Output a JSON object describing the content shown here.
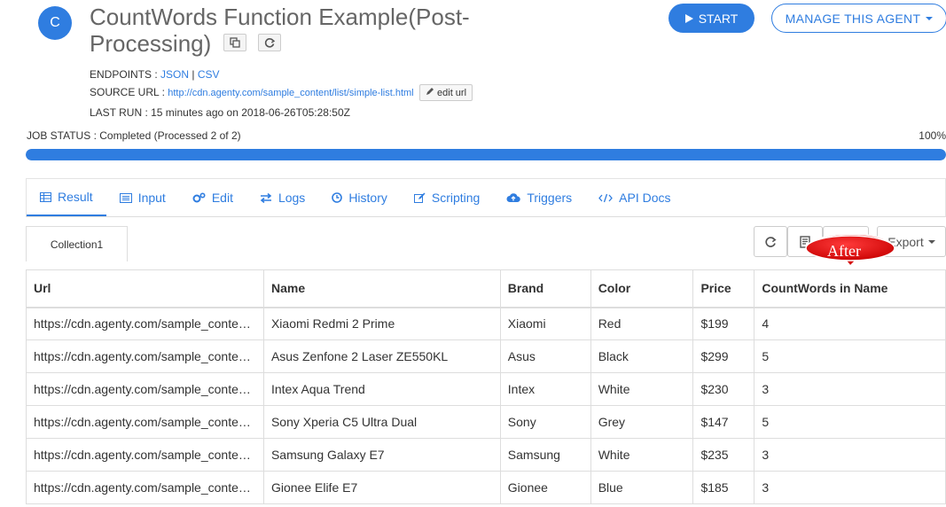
{
  "header": {
    "avatar_letter": "C",
    "title": "CountWords Function Example(Post-Processing)",
    "start_label": "START",
    "manage_label": "MANAGE THIS AGENT"
  },
  "meta": {
    "endpoints_label": "ENDPOINTS :",
    "json_link": "JSON",
    "separator": "|",
    "csv_link": "CSV",
    "source_label": "SOURCE URL :",
    "source_url": "http://cdn.agenty.com/sample_content/list/simple-list.html",
    "edit_url_label": "edit url",
    "last_run": "LAST RUN : 15 minutes ago on 2018-06-26T05:28:50Z"
  },
  "job": {
    "status": "JOB STATUS : Completed (Processed 2 of 2)",
    "percent": "100%",
    "progress": 1.0
  },
  "tabs": [
    {
      "label": "Result",
      "icon": "table-icon"
    },
    {
      "label": "Input",
      "icon": "list-icon"
    },
    {
      "label": "Edit",
      "icon": "gears-icon"
    },
    {
      "label": "Logs",
      "icon": "exchange-icon"
    },
    {
      "label": "History",
      "icon": "clock-icon"
    },
    {
      "label": "Scripting",
      "icon": "edit-icon"
    },
    {
      "label": "Triggers",
      "icon": "cloud-upload-icon"
    },
    {
      "label": "API Docs",
      "icon": "code-icon"
    }
  ],
  "collection_tab": "Collection1",
  "toolbar": {
    "export_label": "Export"
  },
  "annotation": "After",
  "table": {
    "headers": [
      "Url",
      "Name",
      "Brand",
      "Color",
      "Price",
      "CountWords in Name"
    ],
    "rows": [
      [
        "https://cdn.agenty.com/sample_conte…",
        "Xiaomi Redmi 2 Prime",
        "Xiaomi",
        "Red",
        "$199",
        "4"
      ],
      [
        "https://cdn.agenty.com/sample_conte…",
        "Asus Zenfone 2 Laser ZE550KL",
        "Asus",
        "Black",
        "$299",
        "5"
      ],
      [
        "https://cdn.agenty.com/sample_conte…",
        "Intex Aqua Trend",
        "Intex",
        "White",
        "$230",
        "3"
      ],
      [
        "https://cdn.agenty.com/sample_conte…",
        "Sony Xperia C5 Ultra Dual",
        "Sony",
        "Grey",
        "$147",
        "5"
      ],
      [
        "https://cdn.agenty.com/sample_conte…",
        "Samsung Galaxy E7",
        "Samsung",
        "White",
        "$235",
        "3"
      ],
      [
        "https://cdn.agenty.com/sample_conte…",
        "Gionee Elife E7",
        "Gionee",
        "Blue",
        "$185",
        "3"
      ]
    ]
  },
  "colors": {
    "accent": "#2f7de0",
    "callout_red": "#e00000"
  }
}
